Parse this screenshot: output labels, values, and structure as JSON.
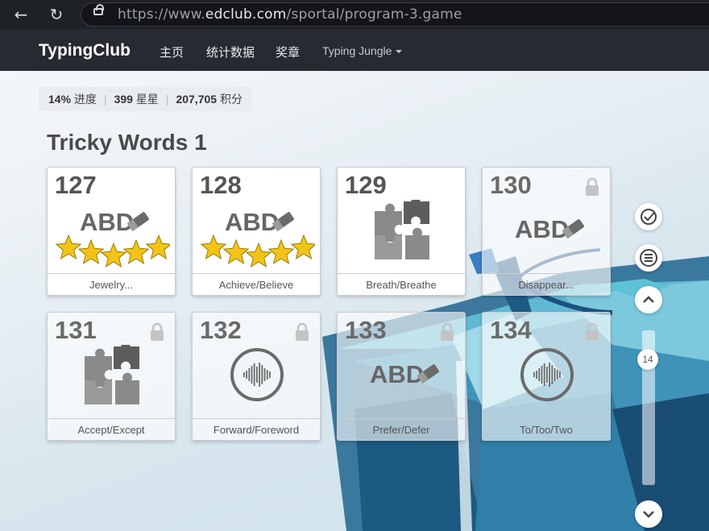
{
  "browser": {
    "url_prefix": "https://www.",
    "url_host": "edclub.com",
    "url_path": "/sportal/program-3.game"
  },
  "header": {
    "brand": "TypingClub",
    "menu": [
      "主页",
      "统计数据",
      "奖章"
    ],
    "program": "Typing Jungle"
  },
  "stats": {
    "progress": "14%",
    "progress_label": "进度",
    "stars": "399",
    "stars_label": "星星",
    "points": "207,705",
    "points_label": "积分"
  },
  "section_title": "Tricky Words 1",
  "lessons": [
    {
      "number": "127",
      "label": "Jewelry...",
      "type": "abd",
      "locked": false,
      "stars": 5
    },
    {
      "number": "128",
      "label": "Achieve/Believe",
      "type": "abd",
      "locked": false,
      "stars": 5
    },
    {
      "number": "129",
      "label": "Breath/Breathe",
      "type": "puzzle",
      "locked": false,
      "stars": 0
    },
    {
      "number": "130",
      "label": "Disappear...",
      "type": "abd",
      "locked": true,
      "stars": 0
    },
    {
      "number": "131",
      "label": "Accept/Except",
      "type": "puzzle",
      "locked": true,
      "stars": 0
    },
    {
      "number": "132",
      "label": "Forward/Foreword",
      "type": "audio",
      "locked": true,
      "stars": 0
    },
    {
      "number": "133",
      "label": "Prefer/Defer",
      "type": "abd",
      "locked": true,
      "stars": 0
    },
    {
      "number": "134",
      "label": "To/Too/Two",
      "type": "audio",
      "locked": true,
      "stars": 0
    }
  ],
  "abd_text": "ABD",
  "side_controls": {
    "page_indicator": "14",
    "icons": [
      "check-circle-icon",
      "menu-icon",
      "chevron-up-icon",
      "chevron-down-icon"
    ]
  },
  "colors": {
    "header_bg": "#272a30",
    "star": "#f3c417",
    "icon_gray": "#6b6b6b"
  }
}
